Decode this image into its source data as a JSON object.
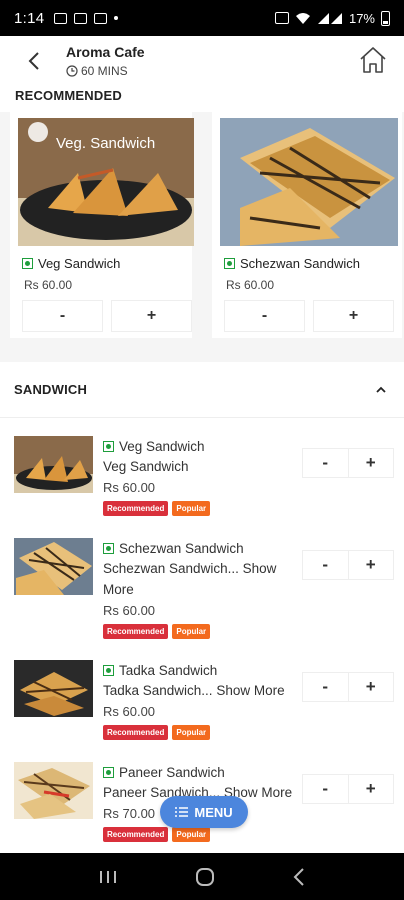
{
  "status_bar": {
    "time": "1:14",
    "battery_percent": "17%",
    "icons": [
      "gallery-icon",
      "mail-icon",
      "app-icon",
      "dot",
      "alarm-icon",
      "wifi-icon",
      "signal-icon",
      "battery-icon"
    ]
  },
  "header": {
    "title": "Aroma Cafe",
    "delivery_time": "60 MINS",
    "back_icon": "back-arrow-icon",
    "home_icon": "home-icon"
  },
  "recommended": {
    "title": "RECOMMENDED",
    "items": [
      {
        "name": "Veg Sandwich",
        "price": "Rs 60.00",
        "image_text": "Veg. Sandwich",
        "minus": "-",
        "plus": "+"
      },
      {
        "name": "Schezwan Sandwich",
        "price": "Rs 60.00",
        "minus": "-",
        "plus": "+"
      }
    ]
  },
  "section": {
    "title": "SANDWICH",
    "items": [
      {
        "name": "Veg Sandwich",
        "desc": "Veg Sandwich",
        "price": "Rs 60.00",
        "badge1": "Recommended",
        "badge2": "Popular",
        "minus": "-",
        "plus": "+"
      },
      {
        "name": "Schezwan Sandwich",
        "desc": "Schezwan Sandwich... Show More",
        "price": "Rs 60.00",
        "badge1": "Recommended",
        "badge2": "Popular",
        "minus": "-",
        "plus": "+"
      },
      {
        "name": "Tadka Sandwich",
        "desc": "Tadka Sandwich... Show More",
        "price": "Rs 60.00",
        "badge1": "Recommended",
        "badge2": "Popular",
        "minus": "-",
        "plus": "+"
      },
      {
        "name": "Paneer Sandwich",
        "desc": "Paneer Sandwich... Show More",
        "price": "Rs 70.00",
        "badge1": "Recommended",
        "badge2": "Popular",
        "minus": "-",
        "plus": "+"
      }
    ]
  },
  "menu_button": {
    "label": "MENU"
  },
  "colors": {
    "veg_green": "#1e9e3c",
    "badge_recommended": "#d9303b",
    "badge_popular": "#f36a1e",
    "menu_blue": "#4c86dd"
  }
}
